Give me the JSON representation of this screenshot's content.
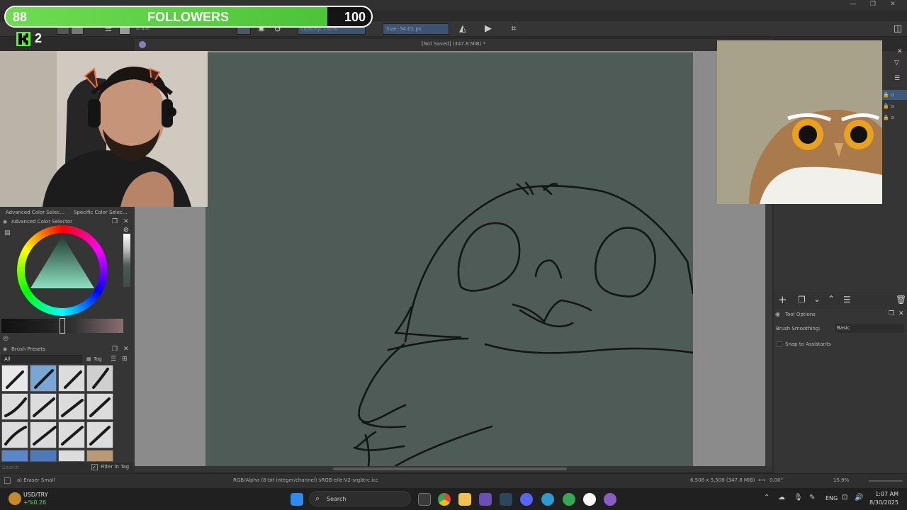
{
  "stream": {
    "followers_current": "88",
    "followers_label": "FOLLOWERS",
    "followers_goal": "100",
    "followers_progress": 0.88,
    "kick_count": "2",
    "kick_color": "#53fc18"
  },
  "toolbar": {
    "brush_name": "Erase",
    "opacity_label": "Opacity: 100%",
    "size_label": "Size: 34.01 px"
  },
  "document": {
    "title": "[Not Saved]  (347.8 MiB) *"
  },
  "left_dockers": {
    "tab_advanced": "Advanced Color Selec...",
    "tab_specific": "Specific Color Selec...",
    "advanced_title": "Advanced Color Selector",
    "brush_presets_title": "Brush Presets",
    "filter_value": "All",
    "tag_label": "Tag",
    "search_placeholder": "Search",
    "filter_in_tag": "Filter in Tag"
  },
  "right_dockers": {
    "tool_options_title": "Tool Options",
    "brush_smoothing_label": "Brush Smoothing:",
    "brush_smoothing_value": "Basic",
    "snap_label": "Snap to Assistants"
  },
  "status": {
    "brush": "a) Eraser Small",
    "color_space": "RGB/Alpha (8-bit integer/channel)  sRGB-elle-V2-srgbtrc.icc",
    "dimensions": "6,508 x 5,508 (347.8 MiB)",
    "rotation": "0.00°",
    "zoom": "15.9%"
  },
  "taskbar": {
    "ticker_name": "USD/TRY",
    "ticker_change": "+%0.26",
    "search_placeholder": "Search",
    "language": "ENG",
    "time": "1:07 AM",
    "date": "8/30/2025"
  },
  "colors": {
    "canvas": "#4f5b57",
    "follow_bar": "#5fd045",
    "krita_panel": "#353535"
  }
}
